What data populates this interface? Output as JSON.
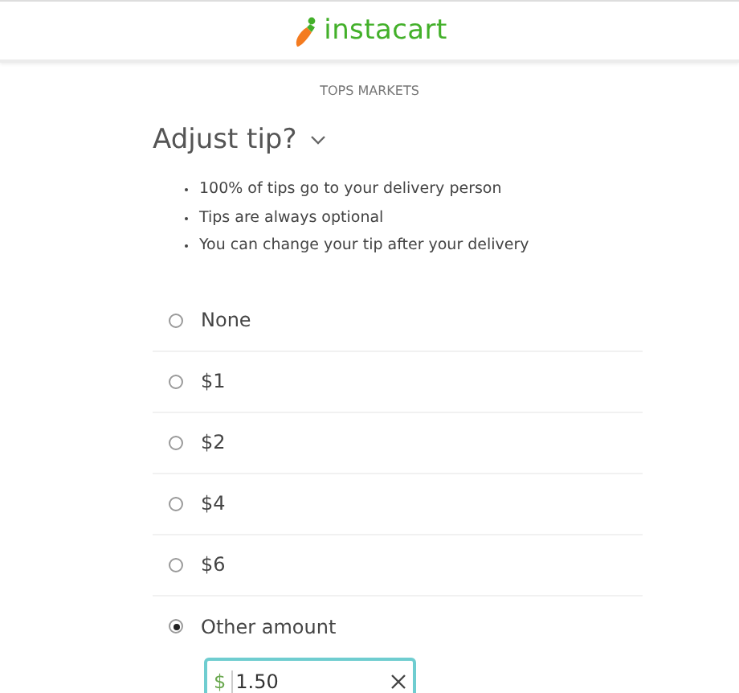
{
  "header": {
    "logo_text": "instacart"
  },
  "store": "TOPS MARKETS",
  "tip": {
    "title": "Adjust tip?",
    "notes": [
      "100% of tips go to your delivery person",
      "Tips are always optional",
      "You can change your tip after your delivery"
    ],
    "options": [
      {
        "label": "None",
        "selected": false
      },
      {
        "label": "$1",
        "selected": false
      },
      {
        "label": "$2",
        "selected": false
      },
      {
        "label": "$4",
        "selected": false
      },
      {
        "label": "$6",
        "selected": false
      },
      {
        "label": "Other amount",
        "selected": true
      }
    ],
    "custom_amount": {
      "prefix": "$",
      "value": "1.50"
    }
  }
}
